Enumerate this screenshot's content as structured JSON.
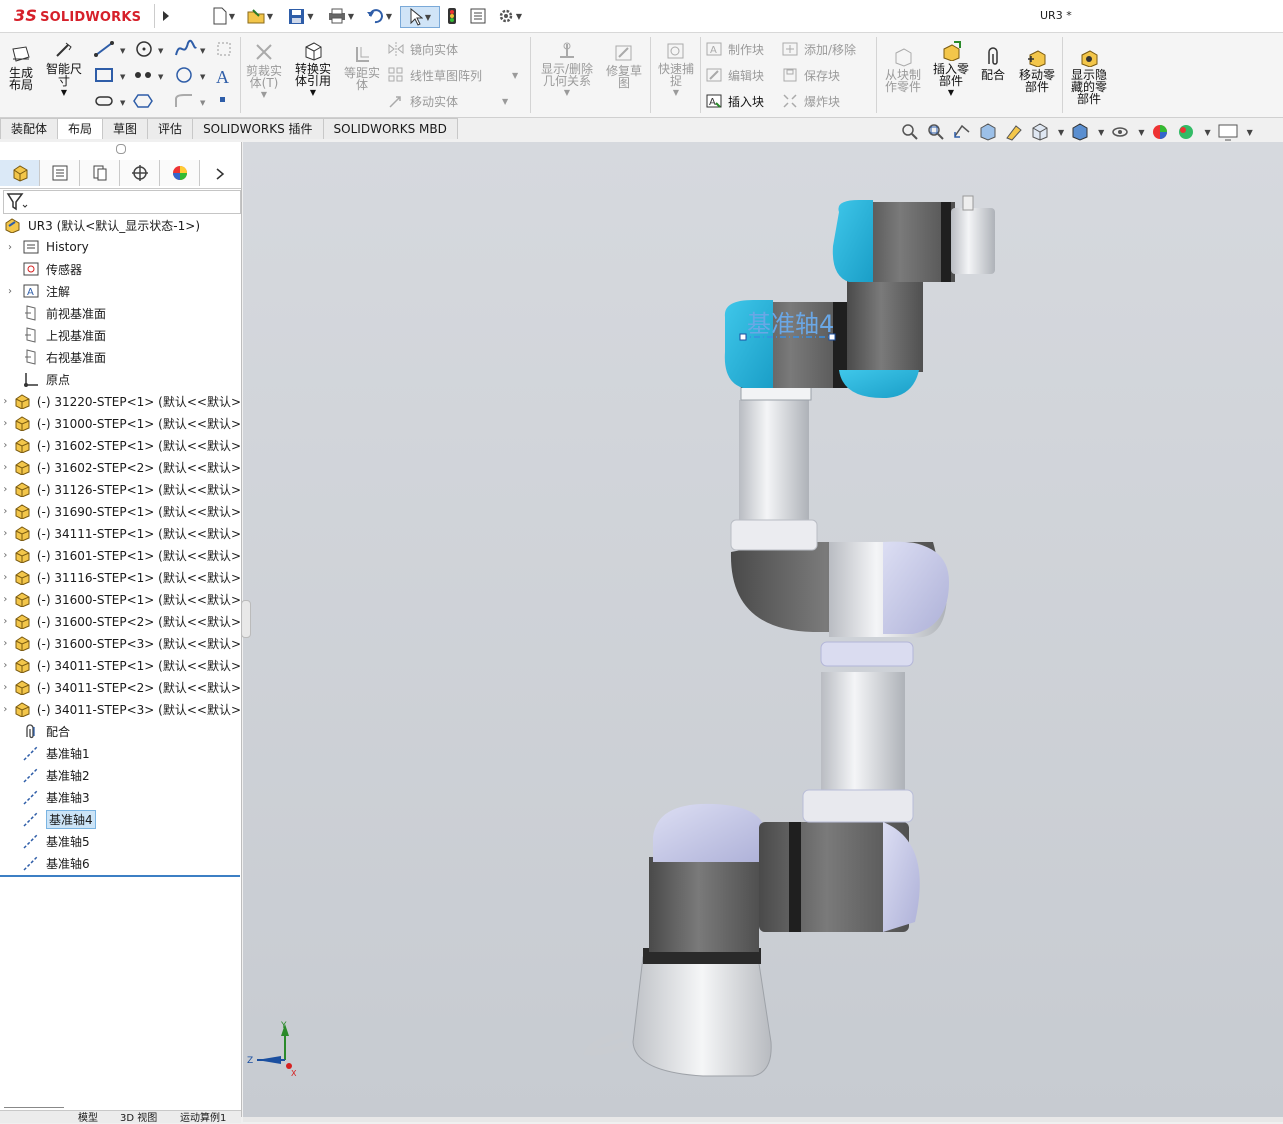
{
  "app": {
    "brand_prefix": "3S",
    "brand": "SOLIDWORKS",
    "document_title": "UR3 *"
  },
  "ribbon": {
    "generate_layout": "生成\n布局",
    "smart_dimension": "智能尺\n寸",
    "trim": "剪裁实\n体(T)",
    "convert": "转换实\n体引用",
    "offset": "等距实\n体",
    "mirror": "镜向实体",
    "linear_pattern": "线性草图阵列",
    "move_entity": "移动实体",
    "display_relations": "显示/删除\n几何关系",
    "repair_sketch": "修复草\n图",
    "quick_snap": "快速捕\n捉",
    "make_block": "制作块",
    "edit_block": "编辑块",
    "insert_block": "插入块",
    "add_remove": "添加/移除",
    "save_block": "保存块",
    "explode_block": "爆炸块",
    "from_block": "从块制\n作零件",
    "insert_component": "插入零\n部件",
    "mate": "配合",
    "move_component": "移动零\n部件",
    "show_hidden": "显示隐\n藏的零\n部件"
  },
  "tabs": [
    "装配体",
    "布局",
    "草图",
    "评估",
    "SOLIDWORKS 插件",
    "SOLIDWORKS MBD"
  ],
  "active_tab": 1,
  "tree": {
    "root": "UR3  (默认<默认_显示状态-1>)",
    "items": [
      {
        "label": "History",
        "icon": "history-icon",
        "exp": true
      },
      {
        "label": "传感器",
        "icon": "sensor-icon",
        "exp": false
      },
      {
        "label": "注解",
        "icon": "annotation-icon",
        "exp": true
      },
      {
        "label": "前视基准面",
        "icon": "plane-icon",
        "exp": false
      },
      {
        "label": "上视基准面",
        "icon": "plane-icon",
        "exp": false
      },
      {
        "label": "右视基准面",
        "icon": "plane-icon",
        "exp": false
      },
      {
        "label": "原点",
        "icon": "origin-icon",
        "exp": false
      },
      {
        "label": "(-) 31220-STEP<1> (默认<<默认>",
        "icon": "part-icon",
        "exp": true
      },
      {
        "label": "(-) 31000-STEP<1> (默认<<默认>",
        "icon": "part-icon",
        "exp": true
      },
      {
        "label": "(-) 31602-STEP<1> (默认<<默认>",
        "icon": "part-icon",
        "exp": true
      },
      {
        "label": "(-) 31602-STEP<2> (默认<<默认>",
        "icon": "part-icon",
        "exp": true
      },
      {
        "label": "(-) 31126-STEP<1> (默认<<默认>",
        "icon": "part-icon",
        "exp": true
      },
      {
        "label": "(-) 31690-STEP<1> (默认<<默认>",
        "icon": "part-icon",
        "exp": true
      },
      {
        "label": "(-) 34111-STEP<1> (默认<<默认>",
        "icon": "part-icon",
        "exp": true
      },
      {
        "label": "(-) 31601-STEP<1> (默认<<默认>",
        "icon": "part-icon",
        "exp": true
      },
      {
        "label": "(-) 31116-STEP<1> (默认<<默认>",
        "icon": "part-icon",
        "exp": true
      },
      {
        "label": "(-) 31600-STEP<1> (默认<<默认>",
        "icon": "part-icon",
        "exp": true
      },
      {
        "label": "(-) 31600-STEP<2> (默认<<默认>",
        "icon": "part-icon",
        "exp": true
      },
      {
        "label": "(-) 31600-STEP<3> (默认<<默认>",
        "icon": "part-icon",
        "exp": true
      },
      {
        "label": "(-) 34011-STEP<1> (默认<<默认>",
        "icon": "part-icon",
        "exp": true
      },
      {
        "label": "(-) 34011-STEP<2> (默认<<默认>",
        "icon": "part-icon",
        "exp": true
      },
      {
        "label": "(-) 34011-STEP<3> (默认<<默认>",
        "icon": "part-icon",
        "exp": true
      },
      {
        "label": "配合",
        "icon": "mates-icon",
        "exp": false
      },
      {
        "label": "基准轴1",
        "icon": "axis-icon",
        "exp": false
      },
      {
        "label": "基准轴2",
        "icon": "axis-icon",
        "exp": false
      },
      {
        "label": "基准轴3",
        "icon": "axis-icon",
        "exp": false
      },
      {
        "label": "基准轴4",
        "icon": "axis-icon",
        "exp": false,
        "selected": true
      },
      {
        "label": "基准轴5",
        "icon": "axis-icon",
        "exp": false
      },
      {
        "label": "基准轴6",
        "icon": "axis-icon",
        "exp": false
      }
    ]
  },
  "viewport": {
    "axis_label": "基准轴4",
    "triad": {
      "x": "X",
      "y": "Y",
      "z": "Z"
    }
  },
  "bottom_tabs": [
    "模型",
    "3D 视图",
    "运动算例1"
  ],
  "colors": {
    "accent": "#d6202a",
    "selection": "#cce4f7",
    "axis_blue": "#6aa7e6",
    "viewport_bg": "#cdd1d6"
  }
}
